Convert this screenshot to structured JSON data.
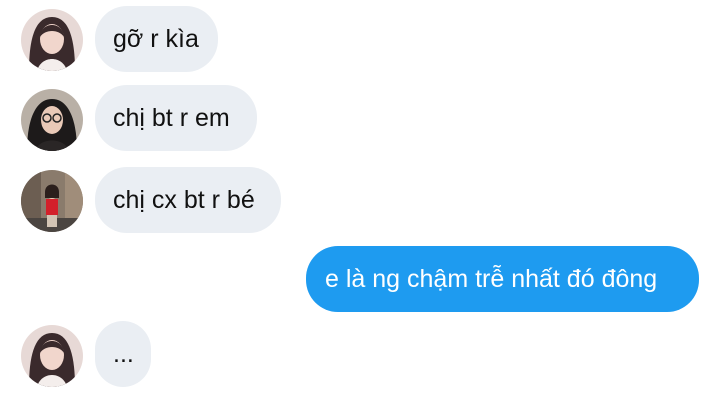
{
  "colors": {
    "incoming_bubble": "#eaeef3",
    "outgoing_bubble": "#1e9bf0",
    "incoming_text": "#111111",
    "outgoing_text": "#ffffff",
    "background": "#ffffff"
  },
  "messages": [
    {
      "direction": "incoming",
      "text": "gỡ r kìa",
      "avatar": "avatar-girl-long-hair"
    },
    {
      "direction": "incoming",
      "text": "chị bt r em",
      "avatar": "avatar-girl-glasses"
    },
    {
      "direction": "incoming",
      "text": "chị cx bt r bé",
      "avatar": "avatar-girl-red-dress"
    },
    {
      "direction": "outgoing",
      "text": "e là ng chậm trễ nhất đó đông"
    },
    {
      "direction": "incoming",
      "text": "...",
      "avatar": "avatar-girl-long-hair"
    }
  ]
}
